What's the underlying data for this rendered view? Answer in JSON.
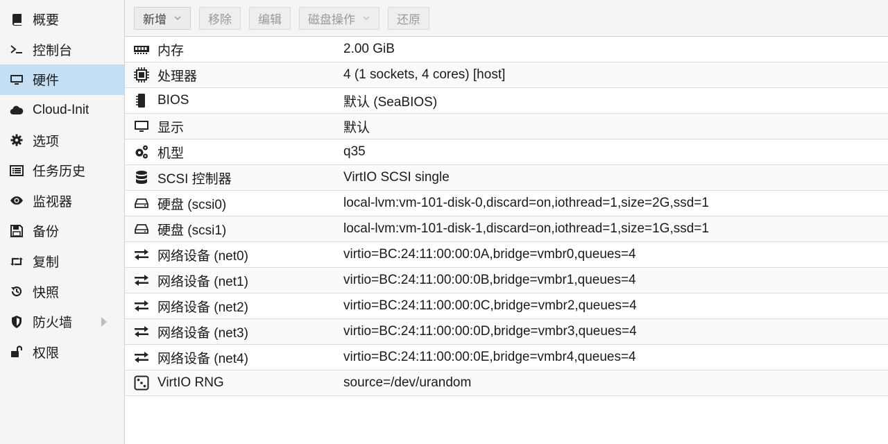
{
  "sidebar": {
    "items": [
      {
        "label": "概要",
        "icon": "book-icon"
      },
      {
        "label": "控制台",
        "icon": "terminal-icon"
      },
      {
        "label": "硬件",
        "icon": "desktop-icon"
      },
      {
        "label": "Cloud-Init",
        "icon": "cloud-icon"
      },
      {
        "label": "选项",
        "icon": "gear-icon"
      },
      {
        "label": "任务历史",
        "icon": "list-icon"
      },
      {
        "label": "监视器",
        "icon": "eye-icon"
      },
      {
        "label": "备份",
        "icon": "floppy-icon"
      },
      {
        "label": "复制",
        "icon": "retweet-icon"
      },
      {
        "label": "快照",
        "icon": "history-icon"
      },
      {
        "label": "防火墙",
        "icon": "shield-icon"
      },
      {
        "label": "权限",
        "icon": "unlock-icon"
      }
    ],
    "active_index": 2
  },
  "toolbar": {
    "add_label": "新增",
    "remove_label": "移除",
    "edit_label": "编辑",
    "disk_action_label": "磁盘操作",
    "revert_label": "还原"
  },
  "hardware": {
    "rows": [
      {
        "icon": "memory-icon",
        "name": "内存",
        "value": "2.00 GiB"
      },
      {
        "icon": "cpu-icon",
        "name": "处理器",
        "value": "4 (1 sockets, 4 cores) [host]"
      },
      {
        "icon": "chip-icon",
        "name": "BIOS",
        "value": "默认 (SeaBIOS)"
      },
      {
        "icon": "desktop-icon",
        "name": "显示",
        "value": "默认"
      },
      {
        "icon": "gears-icon",
        "name": "机型",
        "value": "q35"
      },
      {
        "icon": "database-icon",
        "name": "SCSI 控制器",
        "value": "VirtIO SCSI single"
      },
      {
        "icon": "hdd-icon",
        "name": "硬盘 (scsi0)",
        "value": "local-lvm:vm-101-disk-0,discard=on,iothread=1,size=2G,ssd=1"
      },
      {
        "icon": "hdd-icon",
        "name": "硬盘 (scsi1)",
        "value": "local-lvm:vm-101-disk-1,discard=on,iothread=1,size=1G,ssd=1"
      },
      {
        "icon": "exchange-icon",
        "name": "网络设备 (net0)",
        "value": "virtio=BC:24:11:00:00:0A,bridge=vmbr0,queues=4"
      },
      {
        "icon": "exchange-icon",
        "name": "网络设备 (net1)",
        "value": "virtio=BC:24:11:00:00:0B,bridge=vmbr1,queues=4"
      },
      {
        "icon": "exchange-icon",
        "name": "网络设备 (net2)",
        "value": "virtio=BC:24:11:00:00:0C,bridge=vmbr2,queues=4"
      },
      {
        "icon": "exchange-icon",
        "name": "网络设备 (net3)",
        "value": "virtio=BC:24:11:00:00:0D,bridge=vmbr3,queues=4"
      },
      {
        "icon": "exchange-icon",
        "name": "网络设备 (net4)",
        "value": "virtio=BC:24:11:00:00:0E,bridge=vmbr4,queues=4"
      },
      {
        "icon": "dice-icon",
        "name": "VirtIO RNG",
        "value": "source=/dev/urandom"
      }
    ]
  }
}
